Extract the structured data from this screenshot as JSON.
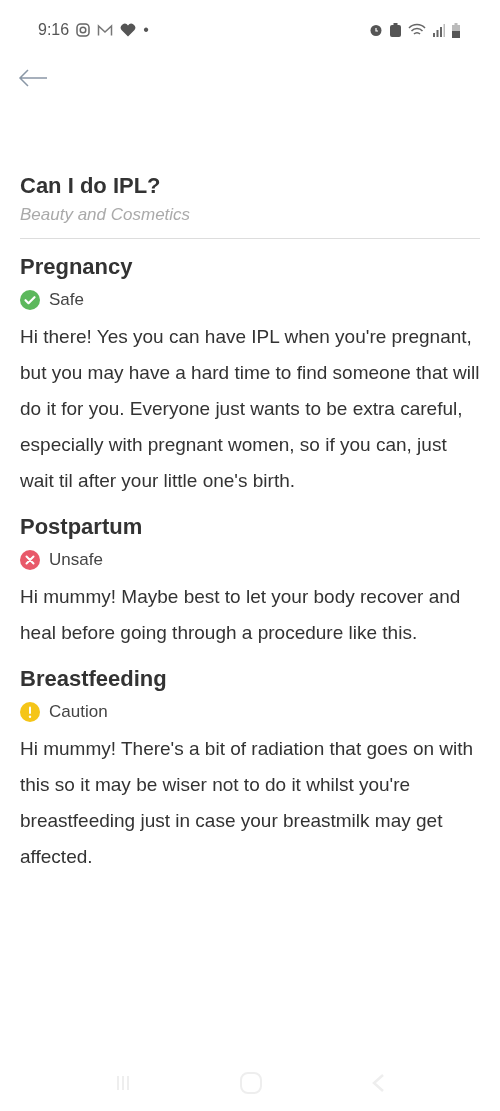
{
  "status_bar": {
    "time": "9:16",
    "notification_dot": "•"
  },
  "title": "Can I do IPL?",
  "category": "Beauty and Cosmetics",
  "sections": [
    {
      "heading": "Pregnancy",
      "kind": "safe",
      "status": "Safe",
      "text": "Hi there! Yes you can have IPL when you're pregnant, but you may have a hard time to find someone that will do it for you. Everyone just wants to be extra careful, especially with pregnant women, so if you can, just wait til after your little one's birth."
    },
    {
      "heading": "Postpartum",
      "kind": "unsafe",
      "status": "Unsafe",
      "text": "Hi mummy! Maybe best to let your body recover and heal before going through a procedure like this."
    },
    {
      "heading": "Breastfeeding",
      "kind": "caution",
      "status": "Caution",
      "text": "Hi  mummy! There's a bit of radiation that goes on with this so it may be wiser not to do it whilst you're breastfeeding just in case your breastmilk may get affected."
    }
  ]
}
